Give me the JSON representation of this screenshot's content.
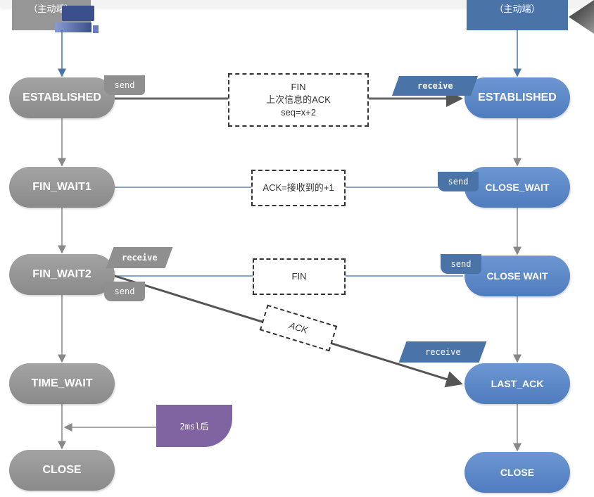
{
  "headers": {
    "left": "（主动端）",
    "right": "（主动端）"
  },
  "left_states": [
    "ESTABLISHED",
    "FIN_WAIT1",
    "FIN_WAIT2",
    "TIME_WAIT",
    "CLOSE"
  ],
  "right_states": [
    "ESTABLISHED",
    "CLOSE_WAIT",
    "CLOSE WAIT",
    "LAST_ACK",
    "CLOSE"
  ],
  "messages": {
    "fin1": [
      "FIN",
      "上次信息的ACK",
      "seq=x+2"
    ],
    "ack1": "ACK=接收到的+1",
    "fin2": "FIN",
    "ack2": "ACK"
  },
  "tags": {
    "send": "send",
    "receive": "receive",
    "timeout": "2msl后"
  },
  "colors": {
    "gray": "#8f8f8f",
    "blue": "#5b86c4",
    "purple": "#8064a2",
    "line_blue": "#5b86c4",
    "line_gray": "#666666"
  }
}
